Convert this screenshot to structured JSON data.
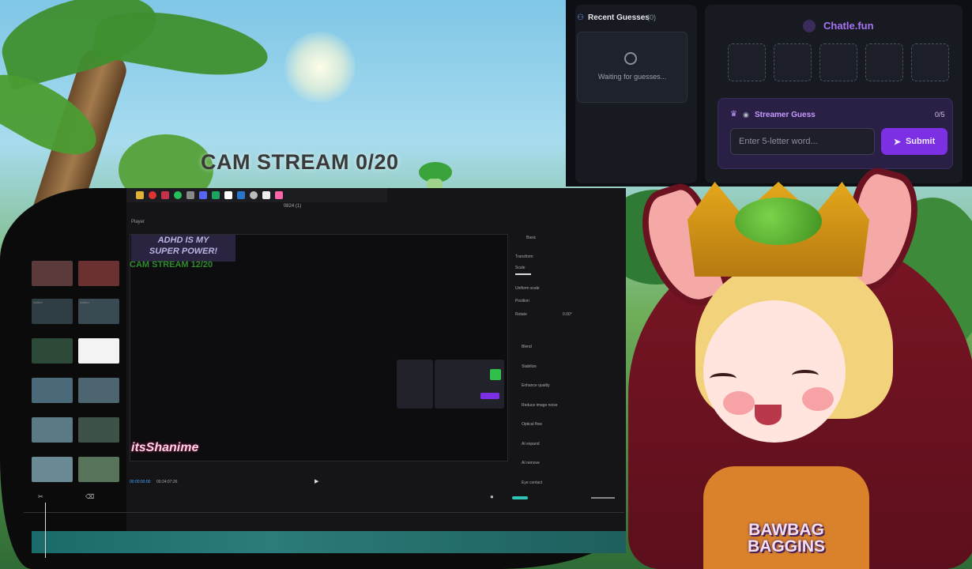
{
  "stream_overlay": {
    "cam_stream": "CAM STREAM 0/20"
  },
  "editor": {
    "project_title": "0824 (1)",
    "player_label": "Player",
    "preview_overlays": {
      "adhd_line1": "ADHD IS MY",
      "adhd_line2": "SUPER POWER!",
      "cam_stream": "CAM STREAM 12/20",
      "logo": "itsShanime"
    },
    "timecode_current": "00:00:00:00",
    "timecode_total": "00:24:07:26",
    "media_tag": "Added",
    "properties": {
      "tab": "Basic",
      "transform": "Transform",
      "scale": "Scale",
      "uniform_scale": "Uniform scale",
      "position": "Position",
      "rotate": "Rotate",
      "rotate_value": "0.00°",
      "blend": "Blend",
      "stabilize": "Stabilize",
      "enhance_quality": "Enhance quality",
      "reduce_noise": "Reduce image noise",
      "optical_flow": "Optical flow",
      "ai_expand": "AI expand",
      "ai_remove": "AI remove",
      "eye_contact": "Eye contact"
    }
  },
  "chatle": {
    "recent_guesses": {
      "title": "Recent Guesses",
      "count": "(0)",
      "waiting": "Waiting for guesses..."
    },
    "brand": "Chatle.fun",
    "slots": [
      "",
      "",
      "",
      "",
      ""
    ],
    "streamer_guess": {
      "title": "Streamer Guess",
      "count": "0/5",
      "placeholder": "Enter 5-letter word...",
      "submit": "Submit"
    }
  },
  "vtuber": {
    "shirt_line1": "BAWBAG",
    "shirt_line2": "BAGGINS"
  },
  "colors": {
    "accent_purple": "#7c2fe3",
    "brand_purple": "#a873f2",
    "panel_dark": "#171a21"
  }
}
